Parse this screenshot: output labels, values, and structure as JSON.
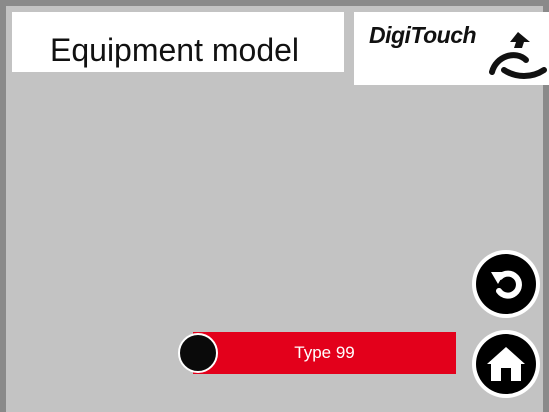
{
  "header": {
    "title": "Equipment model",
    "logo_text": "DigiTouch",
    "logo_icon": "digitouch-swoosh-icon"
  },
  "options": [
    {
      "label": "Type 99",
      "selected": true
    }
  ],
  "nav": {
    "back_icon": "back-arrow-icon",
    "home_icon": "home-icon"
  },
  "colors": {
    "background": "#c3c3c3",
    "accent": "#e3001b",
    "frame": "#8a8a8a"
  }
}
